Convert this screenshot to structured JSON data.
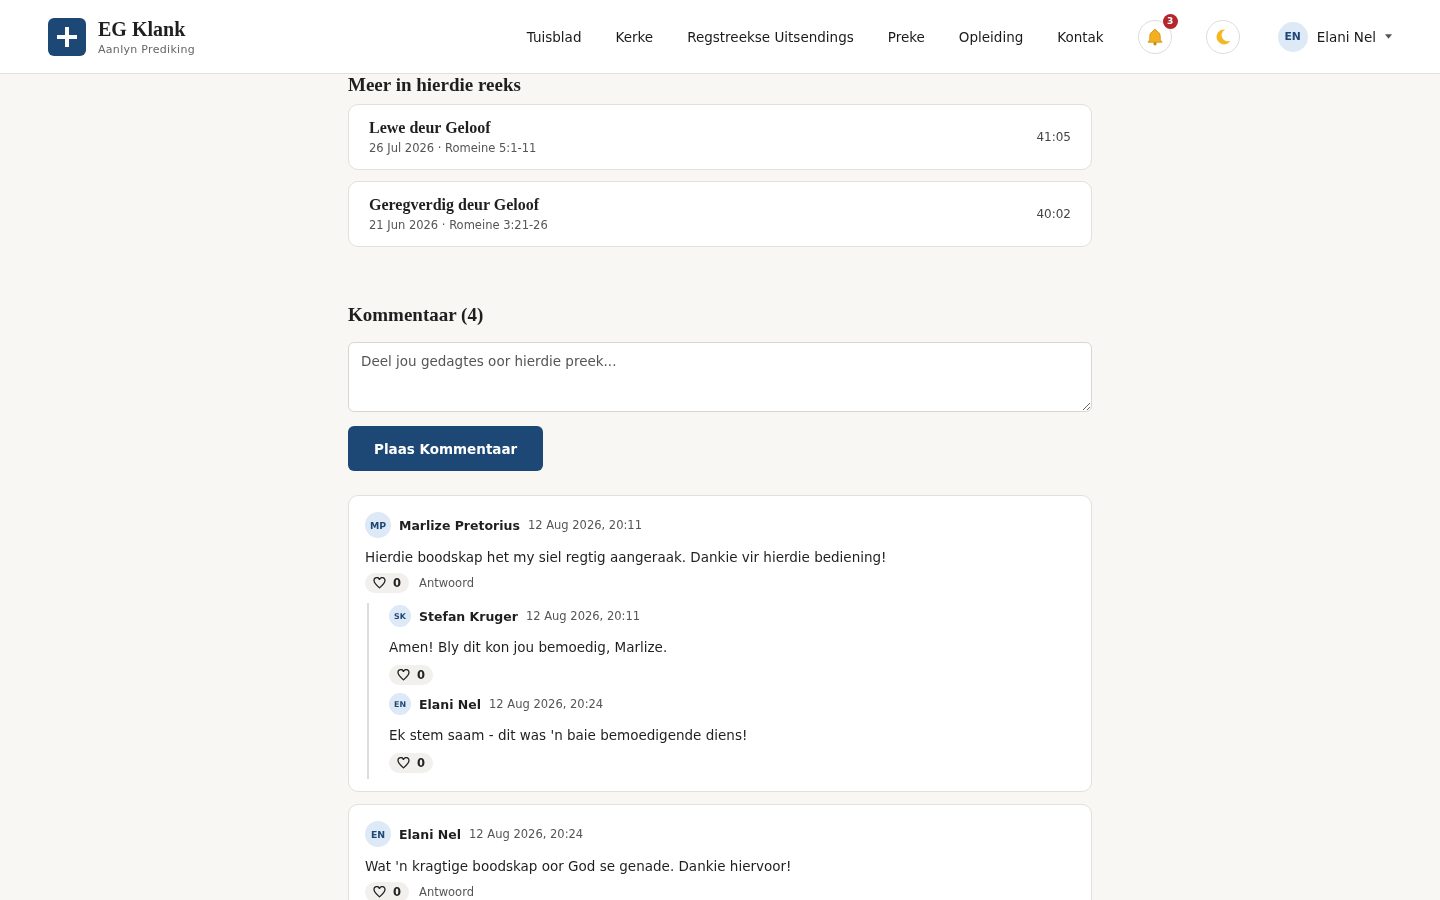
{
  "header": {
    "logo_title": "EG Klank",
    "logo_subtitle": "Aanlyn Prediking",
    "nav": [
      {
        "label": "Tuisblad"
      },
      {
        "label": "Kerke"
      },
      {
        "label": "Regstreekse Uitsendings"
      },
      {
        "label": "Preke"
      },
      {
        "label": "Opleiding"
      },
      {
        "label": "Kontak"
      }
    ],
    "notification_count": "3",
    "user": {
      "initials": "EN",
      "name": "Elani Nel"
    }
  },
  "series": {
    "title": "Meer in hierdie reeks",
    "items": [
      {
        "title": "Lewe deur Geloof",
        "meta": "26 Jul 2026 · Romeine 5:1-11",
        "duration": "41:05"
      },
      {
        "title": "Geregverdig deur Geloof",
        "meta": "21 Jun 2026 · Romeine 3:21-26",
        "duration": "40:02"
      }
    ]
  },
  "comments": {
    "title": "Kommentaar (4)",
    "placeholder": "Deel jou gedagtes oor hierdie preek...",
    "submit": "Plaas Kommentaar",
    "items": [
      {
        "initials": "MP",
        "author": "Marlize Pretorius",
        "time": "12 Aug 2026, 20:11",
        "text": "Hierdie boodskap het my siel regtig aangeraak. Dankie vir hierdie bediening!",
        "likes": "0",
        "reply": "Antwoord",
        "children": [
          {
            "initials": "SK",
            "author": "Stefan Kruger",
            "time": "12 Aug 2026, 20:11",
            "text": "Amen! Bly dit kon jou bemoedig, Marlize.",
            "likes": "0"
          },
          {
            "initials": "EN",
            "author": "Elani Nel",
            "time": "12 Aug 2026, 20:24",
            "text": "Ek stem saam - dit was 'n baie bemoedigende diens!",
            "likes": "0"
          }
        ]
      },
      {
        "initials": "EN",
        "author": "Elani Nel",
        "time": "12 Aug 2026, 20:24",
        "text": "Wat 'n kragtige boodskap oor God se genade. Dankie hiervoor!",
        "likes": "0",
        "reply": "Antwoord"
      }
    ]
  }
}
